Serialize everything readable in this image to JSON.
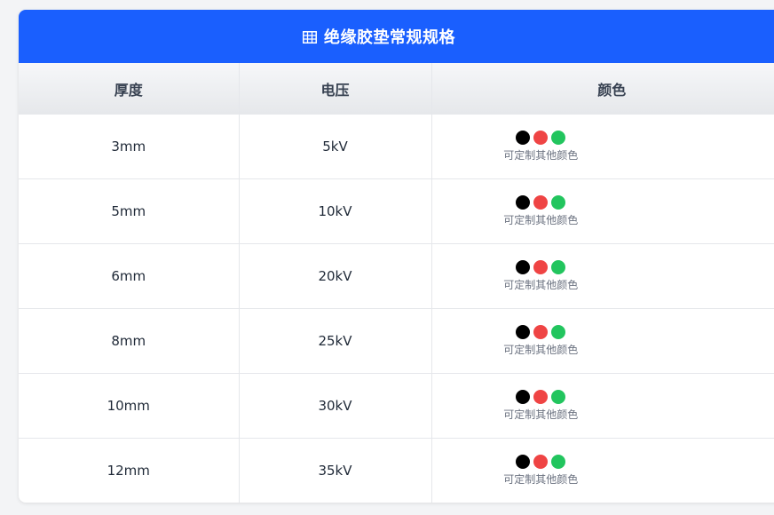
{
  "header": {
    "title": "绝缘胶垫常规规格",
    "icon": "table-icon"
  },
  "columns": [
    "厚度",
    "电压",
    "颜色"
  ],
  "color_note": "可定制其他颜色",
  "colors": {
    "header_bg": "#1a5ffe",
    "black": "#000000",
    "red": "#ef4444",
    "green": "#22c55e"
  },
  "rows": [
    {
      "thickness": "3mm",
      "voltage": "5kV"
    },
    {
      "thickness": "5mm",
      "voltage": "10kV"
    },
    {
      "thickness": "6mm",
      "voltage": "20kV"
    },
    {
      "thickness": "8mm",
      "voltage": "25kV"
    },
    {
      "thickness": "10mm",
      "voltage": "30kV"
    },
    {
      "thickness": "12mm",
      "voltage": "35kV"
    }
  ]
}
